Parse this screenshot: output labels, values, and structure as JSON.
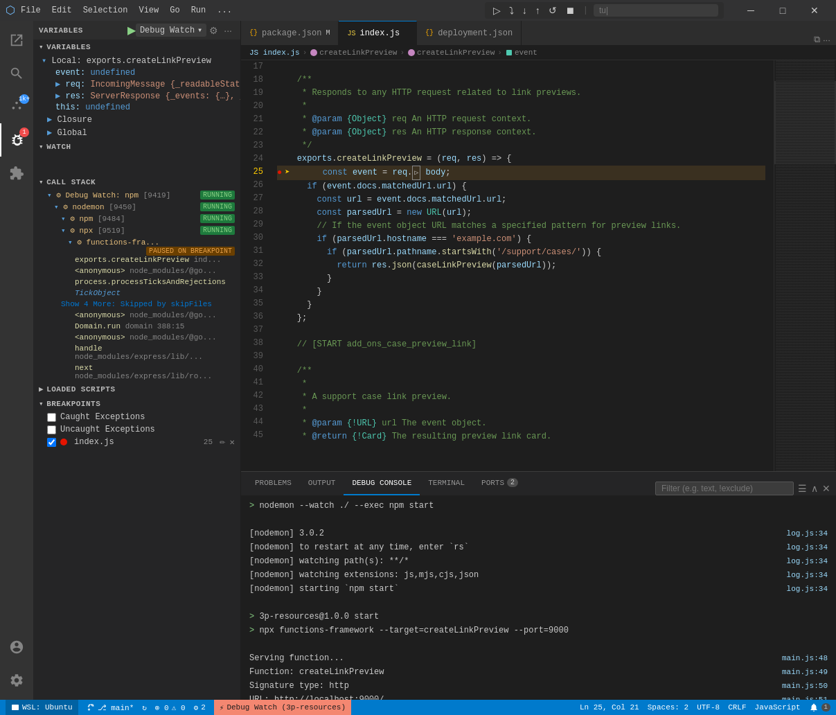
{
  "titleBar": {
    "icon": "⬡",
    "menus": [
      "File",
      "Edit",
      "Selection",
      "View",
      "Go",
      "Run",
      "..."
    ],
    "searchPlaceholder": "tu|",
    "windowControls": [
      "—",
      "□",
      "×"
    ]
  },
  "debugPanel": {
    "runLabel": "▶",
    "configName": "Debug Watch",
    "configIcon": "▾",
    "settingsIcon": "⚙",
    "moreIcon": "..."
  },
  "sections": {
    "variables": "VARIABLES",
    "watch": "WATCH",
    "callStack": "CALL STACK",
    "loadedScripts": "LOADED SCRIPTS",
    "breakpoints": "BREAKPOINTS"
  },
  "variables": {
    "localLabel": "Local: exports.createLinkPreview",
    "items": [
      {
        "key": "event:",
        "value": "undefined",
        "indent": 1
      },
      {
        "key": "req:",
        "value": "IncomingMessage {_readableState:...",
        "indent": 1
      },
      {
        "key": "res:",
        "value": "ServerResponse {_events: {…}, _e...",
        "indent": 1
      },
      {
        "key": "this:",
        "value": "undefined",
        "indent": 1
      }
    ],
    "closureLabel": "Closure",
    "globalLabel": "Global"
  },
  "callStack": {
    "items": [
      {
        "func": "Debug Watch: npm",
        "pid": "[9419]",
        "badge": "RUNNING",
        "badgeType": "running"
      },
      {
        "func": "nodemon",
        "pid": "[9450]",
        "badge": "RUNNING",
        "badgeType": "running",
        "indent": 1
      },
      {
        "func": "npm",
        "pid": "[9484]",
        "badge": "RUNNING",
        "badgeType": "running",
        "indent": 2
      },
      {
        "func": "npx",
        "pid": "[9519]",
        "badge": "RUNNING",
        "badgeType": "running",
        "indent": 2
      },
      {
        "func": "functions-fra...",
        "pid": "",
        "badge": "PAUSED ON BREAKPOINT",
        "badgeType": "paused",
        "indent": 3
      }
    ],
    "frames": [
      {
        "func": "exports.createLinkPreview",
        "file": "ind...",
        "indent": 4
      },
      {
        "func": "<anonymous>",
        "file": "node_modules/@go...",
        "indent": 4
      },
      {
        "func": "process.processTicksAndRejections",
        "file": "",
        "indent": 4
      },
      {
        "func": "TickObject",
        "file": "",
        "indent": 4
      },
      {
        "skipped": "Show 4 More: Skipped by skipFiles",
        "indent": 4
      },
      {
        "func": "<anonymous>",
        "file": "node_modules/@go...",
        "indent": 4
      },
      {
        "func": "Domain.run",
        "file": "domain",
        "extra": "388:15",
        "indent": 4
      },
      {
        "func": "<anonymous>",
        "file": "node_modules/@go...",
        "indent": 4
      },
      {
        "func": "handle",
        "file": "node_modules/express/lib/...",
        "indent": 4
      },
      {
        "func": "next",
        "file": "node_modules/express/lib/ro...",
        "indent": 4
      }
    ]
  },
  "tabs": [
    {
      "label": "package.json",
      "icon": "{}",
      "modified": true,
      "active": false,
      "lang": "M"
    },
    {
      "label": "index.js",
      "icon": "JS",
      "active": true,
      "closable": true
    },
    {
      "label": "deployment.json",
      "icon": "{}",
      "active": false
    }
  ],
  "breadcrumb": [
    "JS index.js",
    "createLinkPreview",
    "createLinkPreview",
    "event"
  ],
  "editor": {
    "filename": "index.js",
    "lines": [
      {
        "num": 17,
        "content": ""
      },
      {
        "num": 18,
        "content": "    /**"
      },
      {
        "num": 19,
        "content": "     * Responds to any HTTP request related to link previews."
      },
      {
        "num": 20,
        "content": "     *"
      },
      {
        "num": 21,
        "content": "     * @param {Object} req An HTTP request context."
      },
      {
        "num": 22,
        "content": "     * @param {Object} res An HTTP response context."
      },
      {
        "num": 23,
        "content": "     */"
      },
      {
        "num": 24,
        "content": "    exports.createLinkPreview = (req, res) => {"
      },
      {
        "num": 25,
        "content": "      const event = req.▷ body;",
        "breakpoint": true,
        "current": true
      },
      {
        "num": 26,
        "content": "      if (event.docs.matchedUrl.url) {"
      },
      {
        "num": 27,
        "content": "        const url = event.docs.matchedUrl.url;"
      },
      {
        "num": 28,
        "content": "        const parsedUrl = new URL(url);"
      },
      {
        "num": 29,
        "content": "        // If the event object URL matches a specified pattern for preview links."
      },
      {
        "num": 30,
        "content": "        if (parsedUrl.hostname === 'example.com') {"
      },
      {
        "num": 31,
        "content": "          if (parsedUrl.pathname.startsWith('/support/cases/')) {"
      },
      {
        "num": 32,
        "content": "            return res.json(caseLinkPreview(parsedUrl));"
      },
      {
        "num": 33,
        "content": "          }"
      },
      {
        "num": 34,
        "content": "        }"
      },
      {
        "num": 35,
        "content": "      }"
      },
      {
        "num": 36,
        "content": "    };"
      },
      {
        "num": 37,
        "content": ""
      },
      {
        "num": 38,
        "content": "    // [START add_ons_case_preview_link]"
      },
      {
        "num": 39,
        "content": ""
      },
      {
        "num": 40,
        "content": "    /**"
      },
      {
        "num": 41,
        "content": "     *"
      },
      {
        "num": 42,
        "content": "     * A support case link preview."
      },
      {
        "num": 43,
        "content": "     *"
      },
      {
        "num": 44,
        "content": "     * @param {!URL} url The event object."
      },
      {
        "num": 45,
        "content": "     * @return {!Card} The resulting preview link card."
      }
    ]
  },
  "panelTabs": [
    {
      "label": "PROBLEMS",
      "active": false
    },
    {
      "label": "OUTPUT",
      "active": false
    },
    {
      "label": "DEBUG CONSOLE",
      "active": true
    },
    {
      "label": "TERMINAL",
      "active": false
    },
    {
      "label": "PORTS",
      "active": false,
      "badge": "2"
    }
  ],
  "debugConsole": {
    "filterPlaceholder": "Filter (e.g. text, !exclude)",
    "lines": [
      {
        "text": "nodemon --watch ./ --exec npm start",
        "link": "",
        "prompt": ">"
      },
      {
        "text": "",
        "link": ""
      },
      {
        "text": "[nodemon] 3.0.2",
        "link": "log.js:34"
      },
      {
        "text": "[nodemon] to restart at any time, enter `rs`",
        "link": "log.js:34"
      },
      {
        "text": "[nodemon] watching path(s): **/*",
        "link": "log.js:34"
      },
      {
        "text": "[nodemon] watching extensions: js,mjs,cjs,json",
        "link": "log.js:34"
      },
      {
        "text": "[nodemon] starting `npm start`",
        "link": "log.js:34"
      },
      {
        "text": "",
        "link": ""
      },
      {
        "text": "3p-resources@1.0.0 start",
        "prompt": ">",
        "link": ""
      },
      {
        "text": "npx functions-framework --target=createLinkPreview --port=9000",
        "prompt": ">",
        "link": ""
      },
      {
        "text": "",
        "link": ""
      },
      {
        "text": "Serving function...",
        "link": "main.js:48"
      },
      {
        "text": "Function: createLinkPreview",
        "link": "main.js:49"
      },
      {
        "text": "Signature type: http",
        "link": "main.js:50"
      },
      {
        "text": "URL: http://localhost:9000/",
        "link": "main.js:51"
      }
    ]
  },
  "statusBar": {
    "git": "⎇ main*",
    "sync": "↻",
    "errors": "⊗ 0",
    "warnings": "⚠ 0",
    "workers": "⚙ 2",
    "debug": "⚡ Debug Watch (3p-resources)",
    "position": "Ln 25, Col 21",
    "spaces": "Spaces: 2",
    "encoding": "UTF-8",
    "eol": "CRLF",
    "language": "JavaScript",
    "wsl": "WSL: Ubuntu"
  },
  "breakpoints": {
    "caughtLabel": "Caught Exceptions",
    "uncaughtLabel": "Uncaught Exceptions",
    "indexJs": "index.js",
    "indexJsLine": "25",
    "caughtChecked": false,
    "uncaughtChecked": false,
    "indexJsChecked": true
  }
}
